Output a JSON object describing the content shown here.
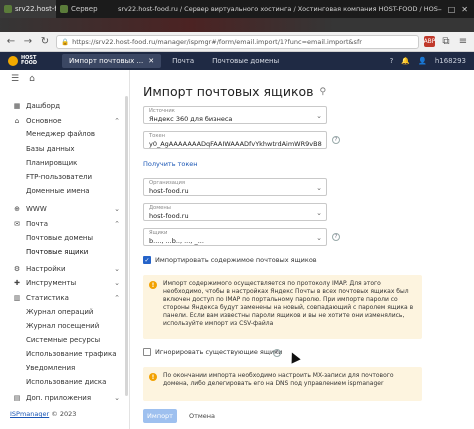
{
  "browser": {
    "tabs": [
      {
        "label": "srv22.host-food.ru",
        "active": true
      },
      {
        "label": "Сервер",
        "active": false
      }
    ],
    "window_title": "srv22.host-food.ru / Сервер виртуального хостинга / Хостинговая компания HOST-FOOD / HOST-FOOD.RU — Mozilla Firefox",
    "url": "https://srv22.host-food.ru/manager/ispmgr#/form/email.import/1?func=email.import&sfr",
    "extensions": [
      "ABP"
    ]
  },
  "app": {
    "logo_text_line1": "HOST",
    "logo_text_line2": "FOOD",
    "top_tabs": [
      {
        "label": "Импорт почтовых ...",
        "active": true
      },
      {
        "label": "Почта",
        "active": false
      },
      {
        "label": "Почтовые домены",
        "active": false
      }
    ],
    "user": "h168293"
  },
  "sidebar": {
    "items": [
      {
        "label": "Дашборд",
        "icon": "dashboard-icon",
        "level": 0
      },
      {
        "label": "Основное",
        "icon": "home-icon",
        "level": 0,
        "expanded": true
      },
      {
        "label": "Менеджер файлов",
        "level": 1
      },
      {
        "label": "Базы данных",
        "level": 1
      },
      {
        "label": "Планировщик",
        "level": 1
      },
      {
        "label": "FTP-пользователи",
        "level": 1
      },
      {
        "label": "Доменные имена",
        "level": 1
      },
      {
        "label": "WWW",
        "icon": "globe-icon",
        "level": 0,
        "expanded": false
      },
      {
        "label": "Почта",
        "icon": "mail-icon",
        "level": 0,
        "expanded": true
      },
      {
        "label": "Почтовые домены",
        "level": 1
      },
      {
        "label": "Почтовые ящики",
        "level": 1
      },
      {
        "label": "Настройки",
        "icon": "settings-icon",
        "level": 0,
        "expanded": false
      },
      {
        "label": "Инструменты",
        "icon": "tools-icon",
        "level": 0,
        "expanded": false
      },
      {
        "label": "Статистика",
        "icon": "stats-icon",
        "level": 0,
        "expanded": true
      },
      {
        "label": "Журнал операций",
        "level": 1
      },
      {
        "label": "Журнал посещений",
        "level": 1
      },
      {
        "label": "Системные ресурсы",
        "level": 1
      },
      {
        "label": "Использование трафика",
        "level": 1
      },
      {
        "label": "Уведомления",
        "level": 1
      },
      {
        "label": "Использование диска",
        "level": 1
      },
      {
        "label": "Доп. приложения",
        "icon": "apps-icon",
        "level": 0,
        "expanded": false
      }
    ],
    "footer_brand": "ISPmanager",
    "footer_year": "© 2023"
  },
  "form": {
    "title": "Импорт почтовых ящиков",
    "source": {
      "label": "Источник",
      "value": "Яндекс 360 для бизнеса"
    },
    "token": {
      "label": "Токен",
      "value": "y0_AgAAAAAAADqFAAIWAAADfvYkhwtrdAimWR9vB8"
    },
    "get_token_link": "Получить токен",
    "organization": {
      "label": "Организация",
      "value": "host-food.ru"
    },
    "domain": {
      "label": "Домены",
      "value": "host-food.ru"
    },
    "mailboxes": {
      "label": "Ящики",
      "value": "b...., ...b.., ..., _..."
    },
    "import_content": {
      "label": "Импортировать содержимое почтовых ящиков",
      "checked": true
    },
    "imap_note": "Импорт содержимого осуществляется по протоколу IMAP. Для этого необходимо, чтобы в настройках Яндекс Почты в всех почтовых ящиках был включен доступ по IMAP по портальному паролю. При импорте пароли со стороны Яндекса будут заменены на новый, совпадающий с паролем ящика в панели. Если вам известны пароли ящиков и вы не хотите они изменялись, используйте импорт из CSV-файла",
    "ignore_existing": {
      "label": "Игнорировать существующие ящики",
      "checked": false
    },
    "mx_note": "По окончании импорта необходимо настроить MX-записи для почтового домена, либо делегировать его на DNS под управлением ispmanager",
    "ok_button": "Импорт",
    "cancel_button": "Отмена"
  }
}
